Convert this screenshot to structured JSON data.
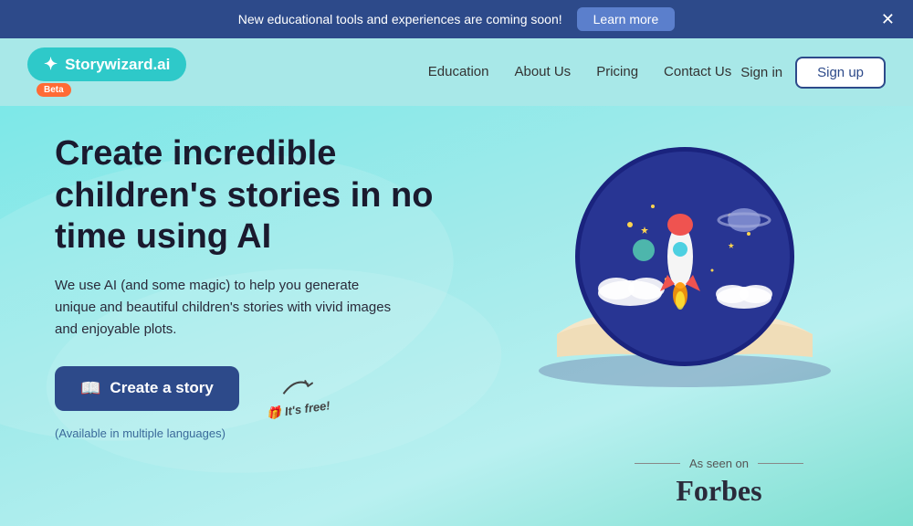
{
  "announcement": {
    "text": "New educational tools and experiences are coming soon!",
    "learn_more_label": "Learn more",
    "close_label": "✕"
  },
  "nav": {
    "logo_text": "Storywizard.ai",
    "beta_label": "Beta",
    "links": [
      {
        "label": "Education",
        "id": "education"
      },
      {
        "label": "About Us",
        "id": "about-us"
      },
      {
        "label": "Pricing",
        "id": "pricing"
      },
      {
        "label": "Contact Us",
        "id": "contact-us"
      }
    ],
    "signin_label": "Sign in",
    "signup_label": "Sign up"
  },
  "hero": {
    "title": "Create incredible children's stories in no time using AI",
    "subtitle": "We use AI (and some magic) to help you generate unique and beautiful children's stories with vivid images and enjoyable plots.",
    "cta_label": "Create a story",
    "available_text": "(Available in multiple languages)",
    "its_free_text": "It's free!"
  },
  "as_seen_on": {
    "label": "As seen on",
    "brand": "Forbes"
  }
}
